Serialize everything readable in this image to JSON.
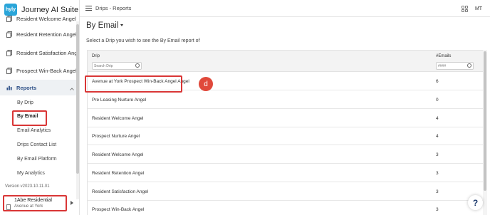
{
  "brand": {
    "logo_text": "hyly",
    "name": "Journey AI Suite"
  },
  "sidebar": {
    "items": [
      {
        "label": "Resident Welcome Angel",
        "icon": "copy-icon"
      },
      {
        "label": "Resident Retention Angel",
        "icon": "copy-icon"
      },
      {
        "label": "Resident Satisfaction Angel...",
        "icon": "copy-icon"
      },
      {
        "label": "Prospect Win-Back Angel",
        "icon": "copy-icon"
      }
    ],
    "reports": {
      "label": "Reports",
      "icon": "bar-chart-icon"
    },
    "sub_items": [
      {
        "label": "By Drip"
      },
      {
        "label": "By Email",
        "selected": true
      },
      {
        "label": "Email Analytics"
      },
      {
        "label": "Drips Contact List"
      },
      {
        "label": "By Email Platform"
      },
      {
        "label": "My Analytics"
      }
    ],
    "version": "Version v2023.10.11.01",
    "account": {
      "name": "1Abe Residential",
      "property": "Avenue at York"
    }
  },
  "topbar": {
    "breadcrumb": "Drips - Reports",
    "avatar": "MT"
  },
  "main": {
    "title": "By Email",
    "instruction": "Select a Drip you wish to see the By Email report of",
    "table": {
      "col_drip": "Drip",
      "col_emails": "#Emails",
      "drip_filter_placeholder": "Search Drip",
      "emails_filter_placeholder": "#### ",
      "rows": [
        {
          "drip": "Avenue at York Prospect Win-Back Angel Angel",
          "emails": "6"
        },
        {
          "drip": "Pre Leasing Nurture Angel",
          "emails": "0"
        },
        {
          "drip": "Resident Welcome Angel",
          "emails": "4"
        },
        {
          "drip": "Prospect Nurture Angel",
          "emails": "4"
        },
        {
          "drip": "Resident Welcome Angel",
          "emails": "3"
        },
        {
          "drip": "Resident Retention Angel",
          "emails": "3"
        },
        {
          "drip": "Resident Satisfaction Angel",
          "emails": "3"
        },
        {
          "drip": "Prospect Win-Back Angel",
          "emails": "3"
        }
      ]
    }
  },
  "annotation": {
    "step": "d"
  },
  "help": {
    "label": "?"
  },
  "colors": {
    "highlight": "#d93636",
    "badge": "#e0493b",
    "brand": "#2aa5d9",
    "reports_active": "#2c4f86"
  }
}
